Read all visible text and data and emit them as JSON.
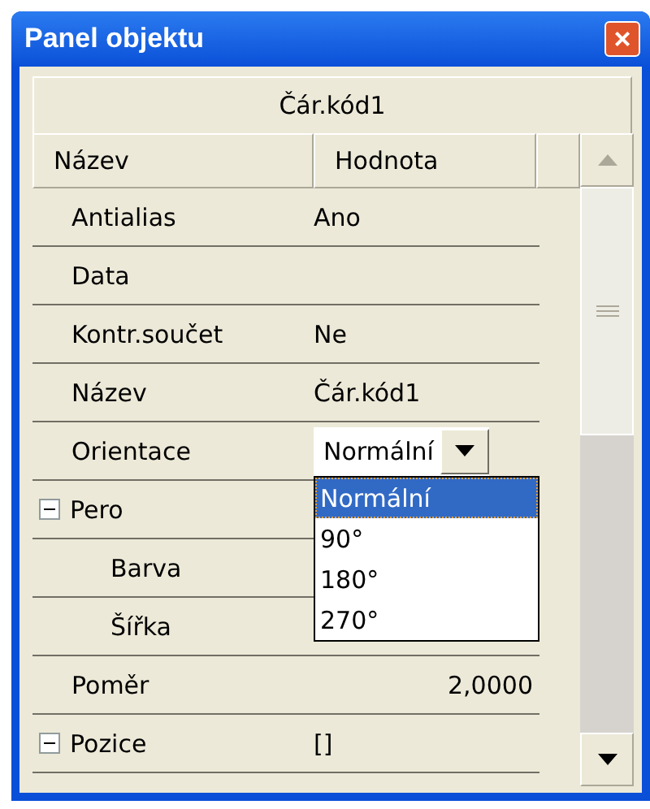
{
  "window": {
    "title": "Panel objektu",
    "close": "×"
  },
  "object_name": "Čár.kód1",
  "columns": [
    "Název",
    "Hodnota"
  ],
  "rows": [
    {
      "kind": "text",
      "name": "Antialias",
      "value": "Ano"
    },
    {
      "kind": "text",
      "name": "Data"
    },
    {
      "kind": "text",
      "name": "Kontr.součet",
      "value": "Ne"
    },
    {
      "kind": "text",
      "name": "Název",
      "value": "Čár.kód1"
    },
    {
      "kind": "dropdown",
      "name": "Orientace",
      "value": "Normální",
      "open": true,
      "options": [
        {
          "label": "Normální",
          "selected": true
        },
        {
          "label": "90°",
          "selected": false
        },
        {
          "label": "180°",
          "selected": false
        },
        {
          "label": "270°",
          "selected": false
        }
      ]
    },
    {
      "kind": "group",
      "name": "Pero",
      "expanded": true,
      "children": [
        {
          "kind": "text",
          "name": "Barva"
        },
        {
          "kind": "text",
          "name": "Šířka"
        }
      ]
    },
    {
      "kind": "number",
      "name": "Poměr",
      "value": "2,0000"
    },
    {
      "kind": "group",
      "name": "Pozice",
      "value": "[]",
      "expanded": true
    }
  ]
}
